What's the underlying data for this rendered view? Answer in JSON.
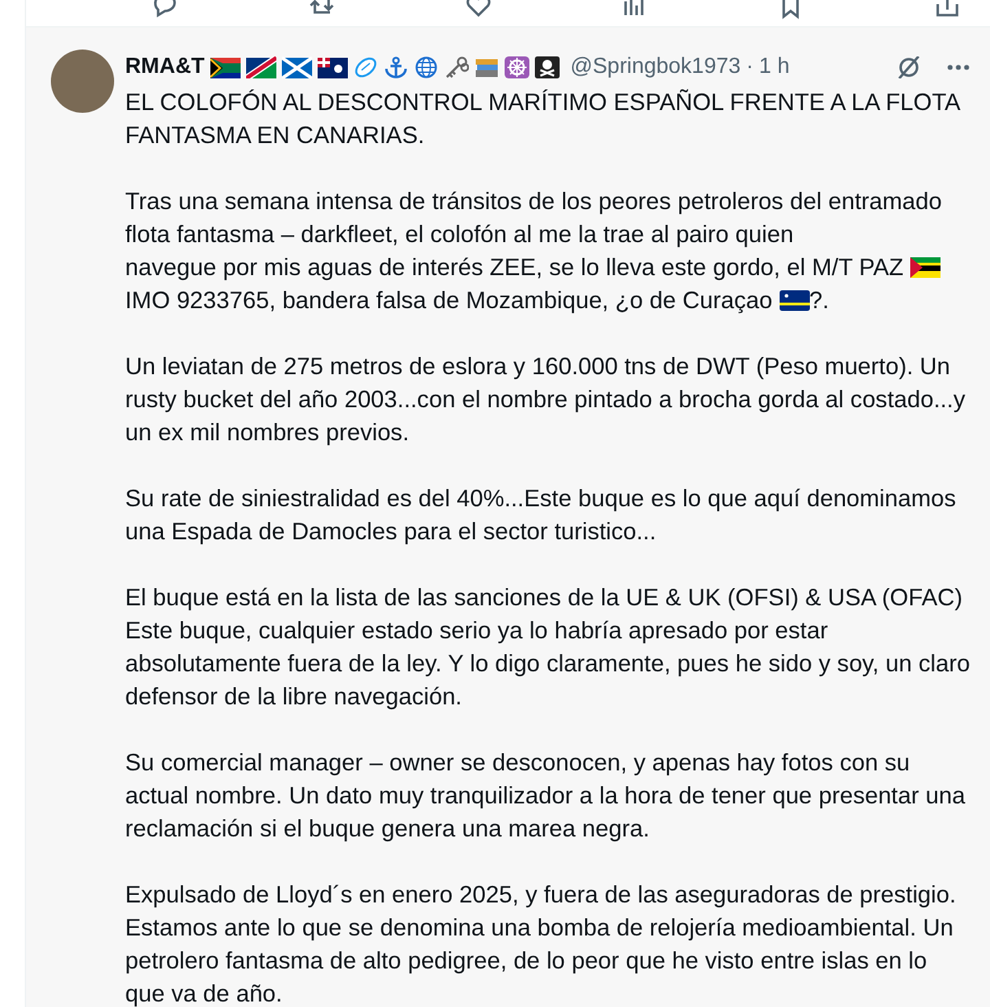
{
  "post": {
    "author": {
      "name": "RMA&T",
      "handle": "@Springbok1973",
      "time": "1 h",
      "separator": "·"
    },
    "paragraphs": [
      [
        {
          "kind": "text",
          "text": "EL COLOFÓN AL DESCONTROL MARÍTIMO ESPAÑOL FRENTE A LA FLOTA FANTASMA EN CANARIAS."
        }
      ],
      [
        {
          "kind": "text",
          "text": "Tras una semana intensa de tránsitos de los peores petroleros del entramado flota fantasma – darkfleet, el colofón al me la trae al pairo quien"
        },
        {
          "kind": "break"
        },
        {
          "kind": "text",
          "text": "navegue por mis aguas de interés ZEE, se lo lleva este gordo, el M/T PAZ"
        },
        {
          "kind": "flag"
        },
        {
          "kind": "break"
        },
        {
          "kind": "text",
          "text": "IMO 9233765, bandera falsa de Mozambique, ¿o de Curaçao"
        },
        {
          "kind": "flag"
        },
        {
          "kind": "text",
          "text": "?."
        }
      ],
      [
        {
          "kind": "text",
          "text": "Un leviatan de 275 metros de eslora y 160.000 tns de DWT (Peso muerto). Un rusty bucket del año 2003...con el nombre pintado a brocha gorda al costado...y un ex mil nombres previos."
        }
      ],
      [
        {
          "kind": "text",
          "text": "Su rate de siniestralidad es del 40%...Este buque es lo que aquí denominamos una Espada de Damocles para el sector turistico..."
        }
      ],
      [
        {
          "kind": "text",
          "text": "El buque está en la lista de las sanciones de la UE & UK (OFSI) & USA (OFAC) Este buque, cualquier estado serio ya lo habría apresado por estar absolutamente fuera de la ley. Y lo digo claramente, pues he sido y soy, un claro defensor de la libre navegación."
        }
      ],
      [
        {
          "kind": "text",
          "text": "Su comercial manager – owner se desconocen, y apenas hay fotos con su actual nombre. Un dato muy tranquilizador a la hora de tener que presentar una reclamación si el buque genera una marea negra."
        }
      ],
      [
        {
          "kind": "text",
          "text": "Expulsado de Lloyd´s en enero 2025, y fuera de las aseguradoras de prestigio. Estamos ante lo que se denomina una bomba de relojería medioambiental. Un petrolero fantasma de alto pedigree, de lo peor que he visto entre islas en lo que va de año."
        }
      ]
    ]
  }
}
